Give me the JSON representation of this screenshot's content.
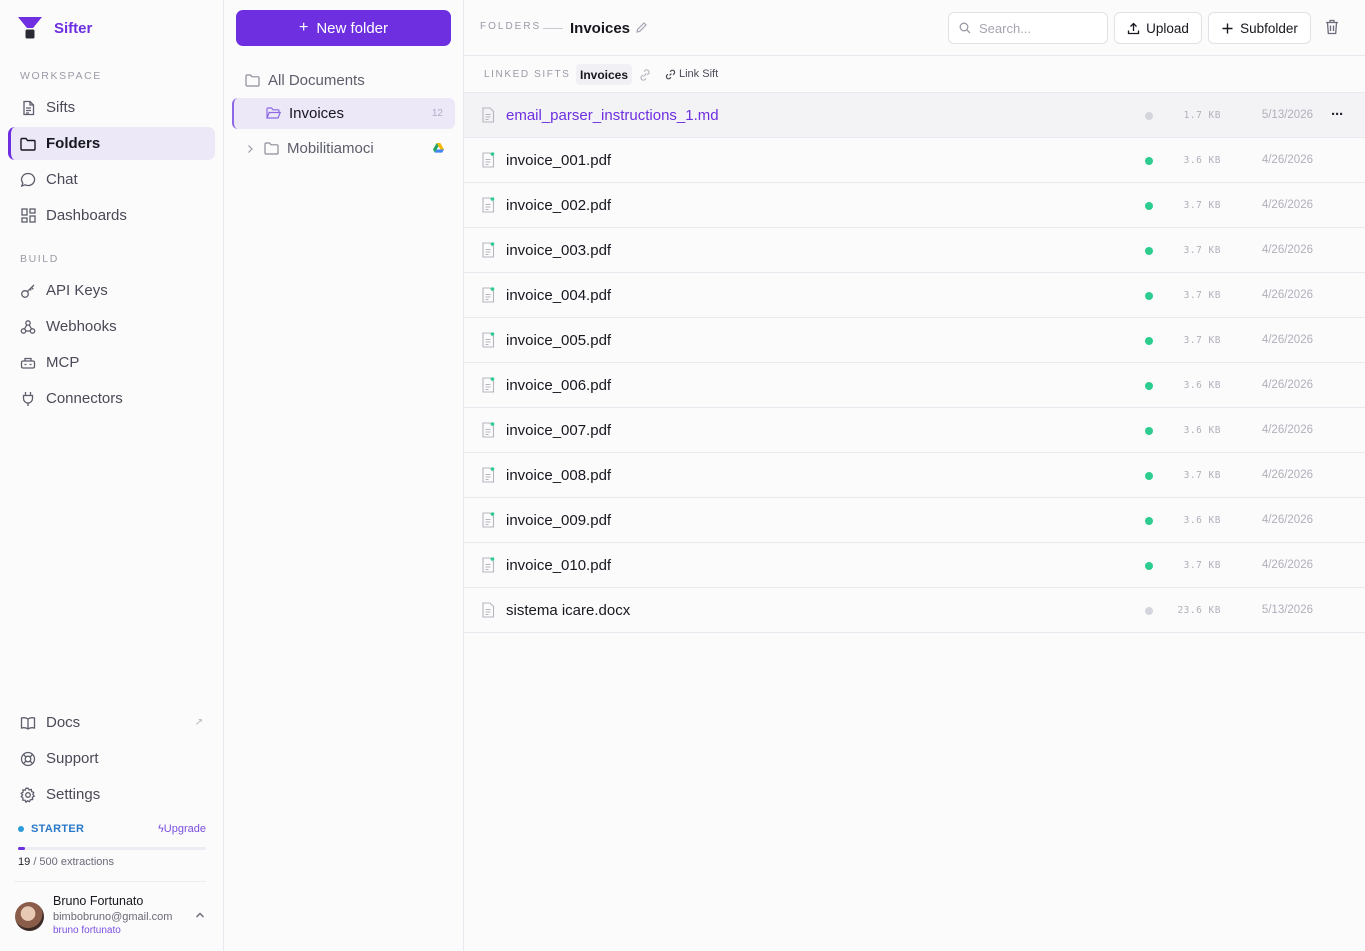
{
  "brand": {
    "name": "Sifter"
  },
  "sidebar": {
    "workspace_label": "WORKSPACE",
    "build_label": "BUILD",
    "workspace": [
      {
        "label": "Sifts",
        "icon": "file-text-icon"
      },
      {
        "label": "Folders",
        "icon": "folder-icon",
        "active": true
      },
      {
        "label": "Chat",
        "icon": "chat-bubble-icon"
      },
      {
        "label": "Dashboards",
        "icon": "dashboard-grid-icon"
      }
    ],
    "build": [
      {
        "label": "API Keys",
        "icon": "key-icon"
      },
      {
        "label": "Webhooks",
        "icon": "webhook-icon"
      },
      {
        "label": "MCP",
        "icon": "mcp-icon"
      },
      {
        "label": "Connectors",
        "icon": "plug-icon"
      }
    ],
    "bottom": [
      {
        "label": "Docs",
        "icon": "book-icon",
        "external": "↗"
      },
      {
        "label": "Support",
        "icon": "lifebuoy-icon"
      },
      {
        "label": "Settings",
        "icon": "gear-icon"
      }
    ],
    "plan": {
      "name": "STARTER",
      "upgrade": "Upgrade",
      "used": "19",
      "limit_text": "/ 500 extractions",
      "progress": 0.038
    },
    "user": {
      "name": "Bruno Fortunato",
      "email": "bimbobruno@gmail.com",
      "handle": "bruno fortunato"
    }
  },
  "folders": {
    "new_button": "New folder",
    "all_documents": "All Documents",
    "items": [
      {
        "name": "Invoices",
        "count": "12",
        "active": true
      },
      {
        "name": "Mobilitiamoci",
        "drive": true
      }
    ]
  },
  "main": {
    "breadcrumb_root": "FOLDERS",
    "breadcrumb_current": "Invoices",
    "search_placeholder": "Search...",
    "upload_label": "Upload",
    "subfolder_label": "Subfolder",
    "linked_label": "LINKED SIFTS",
    "linked_sift": "Invoices",
    "link_sift_label": "Link Sift",
    "status_colors": {
      "processed": "#2ecc8f",
      "pending": "#d4d4dc"
    },
    "files": [
      {
        "name": "email_parser_instructions_1.md",
        "size": "1.7 KB",
        "date": "5/13/2026",
        "status": "pending",
        "selected": true
      },
      {
        "name": "invoice_001.pdf",
        "size": "3.6 KB",
        "date": "4/26/2026",
        "status": "processed"
      },
      {
        "name": "invoice_002.pdf",
        "size": "3.7 KB",
        "date": "4/26/2026",
        "status": "processed"
      },
      {
        "name": "invoice_003.pdf",
        "size": "3.7 KB",
        "date": "4/26/2026",
        "status": "processed"
      },
      {
        "name": "invoice_004.pdf",
        "size": "3.7 KB",
        "date": "4/26/2026",
        "status": "processed"
      },
      {
        "name": "invoice_005.pdf",
        "size": "3.7 KB",
        "date": "4/26/2026",
        "status": "processed"
      },
      {
        "name": "invoice_006.pdf",
        "size": "3.6 KB",
        "date": "4/26/2026",
        "status": "processed"
      },
      {
        "name": "invoice_007.pdf",
        "size": "3.6 KB",
        "date": "4/26/2026",
        "status": "processed"
      },
      {
        "name": "invoice_008.pdf",
        "size": "3.7 KB",
        "date": "4/26/2026",
        "status": "processed"
      },
      {
        "name": "invoice_009.pdf",
        "size": "3.6 KB",
        "date": "4/26/2026",
        "status": "processed"
      },
      {
        "name": "invoice_010.pdf",
        "size": "3.7 KB",
        "date": "4/26/2026",
        "status": "processed"
      },
      {
        "name": "sistema icare.docx",
        "size": "23.6 KB",
        "date": "5/13/2026",
        "status": "pending"
      }
    ]
  }
}
